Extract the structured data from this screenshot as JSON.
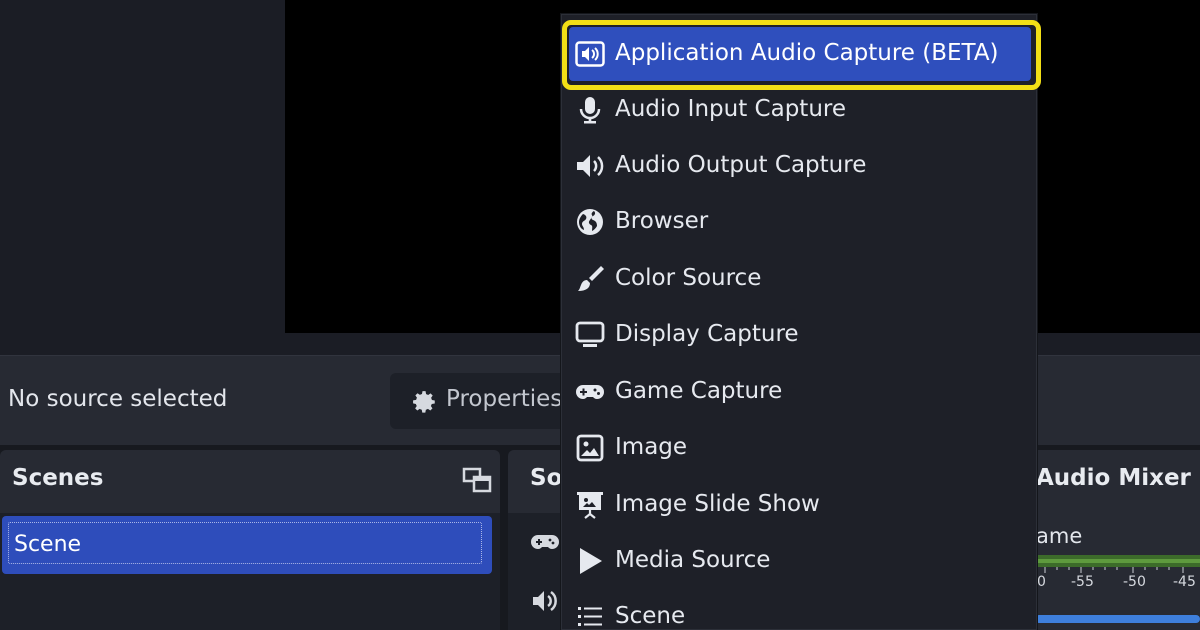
{
  "context": {
    "no_source": "No source selected",
    "properties_label": "Properties"
  },
  "scenes": {
    "title": "Scenes",
    "items": [
      "Scene"
    ]
  },
  "sources": {
    "title_visible": "So"
  },
  "mixer": {
    "title": "Audio Mixer",
    "channel_name_visible": "ame",
    "ticks": [
      "0",
      "-55",
      "-50",
      "-45"
    ]
  },
  "menu": {
    "items": [
      {
        "label": "Application Audio Capture (BETA)",
        "icon": "app-audio-icon",
        "highlighted": true
      },
      {
        "label": "Audio Input Capture",
        "icon": "microphone-icon"
      },
      {
        "label": "Audio Output Capture",
        "icon": "speaker-icon"
      },
      {
        "label": "Browser",
        "icon": "globe-icon"
      },
      {
        "label": "Color Source",
        "icon": "paint-brush-icon"
      },
      {
        "label": "Display Capture",
        "icon": "monitor-icon"
      },
      {
        "label": "Game Capture",
        "icon": "gamepad-icon"
      },
      {
        "label": "Image",
        "icon": "image-icon"
      },
      {
        "label": "Image Slide Show",
        "icon": "slideshow-icon"
      },
      {
        "label": "Media Source",
        "icon": "play-icon"
      },
      {
        "label": "Scene",
        "icon": "list-icon"
      }
    ]
  },
  "colors": {
    "highlight": "#2f4fbd",
    "annotation_ring": "#f2df16",
    "panel": "#272a33",
    "preview": "#000000"
  }
}
